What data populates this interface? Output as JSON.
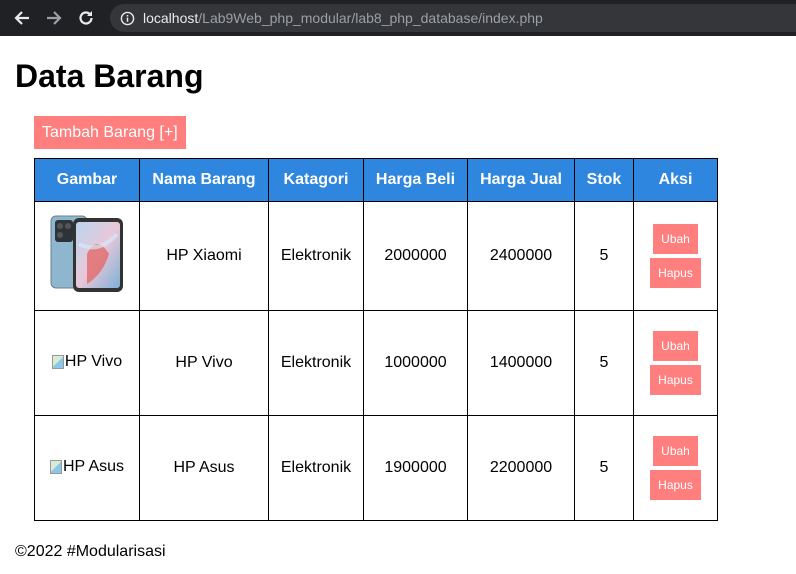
{
  "browser": {
    "url_host": "localhost",
    "url_path": "/Lab9Web_php_modular/lab8_php_database/index.php"
  },
  "page": {
    "title": "Data Barang",
    "add_button": "Tambah Barang [+]",
    "footer": "©2022 #Modularisasi"
  },
  "table": {
    "headers": [
      "Gambar",
      "Nama Barang",
      "Katagori",
      "Harga Beli",
      "Harga Jual",
      "Stok",
      "Aksi"
    ],
    "rows": [
      {
        "gambar": "",
        "nama": "HP Xiaomi",
        "kategori": "Elektronik",
        "harga_beli": "2000000",
        "harga_jual": "2400000",
        "stok": "5",
        "ubah": "Ubah",
        "hapus": "Hapus"
      },
      {
        "gambar": "HP Vivo",
        "nama": "HP Vivo",
        "kategori": "Elektronik",
        "harga_beli": "1000000",
        "harga_jual": "1400000",
        "stok": "5",
        "ubah": "Ubah",
        "hapus": "Hapus"
      },
      {
        "gambar": "HP Asus",
        "nama": "HP Asus",
        "kategori": "Elektronik",
        "harga_beli": "1900000",
        "harga_jual": "2200000",
        "stok": "5",
        "ubah": "Ubah",
        "hapus": "Hapus"
      }
    ]
  },
  "colors": {
    "header_bg": "#2e86de",
    "button_bg": "#ff7f7f"
  }
}
